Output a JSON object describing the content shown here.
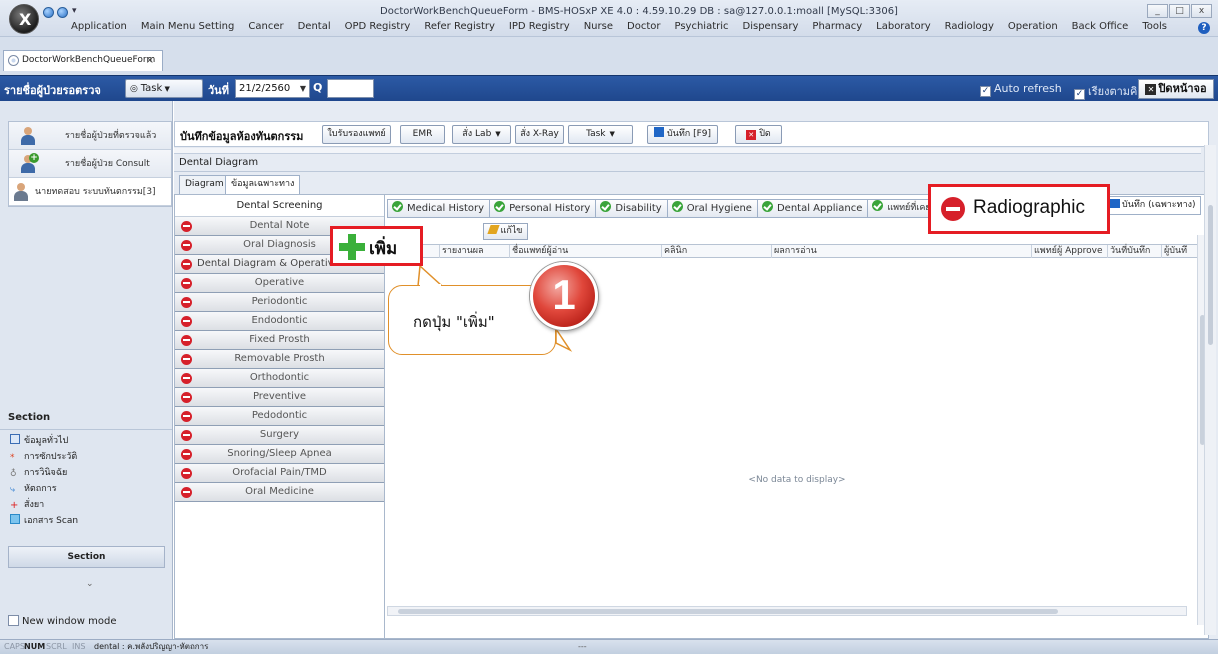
{
  "window": {
    "title": "DoctorWorkBenchQueueForm - BMS-HOSxP XE 4.0 : 4.59.10.29 DB : sa@127.0.0.1:moall [MySQL:3306]",
    "buttons": [
      "_",
      "□",
      "x"
    ]
  },
  "menu": [
    "Application",
    "Main Menu Setting",
    "Cancer",
    "Dental",
    "OPD Registry",
    "Refer Registry",
    "IPD Registry",
    "Nurse",
    "Doctor",
    "Psychiatric",
    "Dispensary",
    "Pharmacy",
    "Laboratory",
    "Radiology",
    "Operation",
    "Back Office",
    "Tools"
  ],
  "doc_tab": {
    "label": "DoctorWorkBenchQueueForm",
    "close": "×"
  },
  "toolbar": {
    "title": "รายชื่อผู้ป่วยรอตรวจ",
    "task_label": "Task",
    "date_label": "วันที่",
    "date_value": "21/2/2560",
    "q_label": "Q",
    "q_value": "",
    "auto_refresh": "Auto refresh",
    "sort_queue": "เรียงตามคิว",
    "close_screen": "ปิดหน้าจอ"
  },
  "patient_list": [
    {
      "label": "รายชื่อผู้ป่วยที่ตรวจแล้ว"
    },
    {
      "label": "รายชื่อผู้ป่วย Consult"
    },
    {
      "label": "นายทดสอบ ระบบทันตกรรม[3]"
    }
  ],
  "section": {
    "title": "Section",
    "items": [
      "ข้อมูลทั่วไป",
      "การซักประวัติ",
      "การวินิจฉัย",
      "หัตถการ",
      "สั่งยา",
      "เอกสาร Scan"
    ],
    "button": "Section",
    "dropdown": "⌄",
    "new_window": "New window mode"
  },
  "form": {
    "title": "บันทึกข้อมูลห้องทันตกรรม",
    "buttons": {
      "doctor_cert": "ใบรับรองแพทย์",
      "emr": "EMR",
      "order_lab": "สั่ง Lab",
      "order_xray": "สั่ง X-Ray",
      "task": "Task",
      "save": "บันทึก [F9]",
      "close": "ปิด"
    },
    "diagram_label": "Dental Diagram",
    "subtabs": [
      "Diagram",
      "ข้อมูลเฉพาะทาง"
    ]
  },
  "screening": {
    "header": "Dental Screening",
    "items": [
      "Dental Note",
      "Oral Diagnosis",
      "Dental Diagram & Operative Diagnosis",
      "Operative",
      "Periodontic",
      "Endodontic",
      "Fixed Prosth",
      "Removable Prosth",
      "Orthodontic",
      "Preventive",
      "Pedodontic",
      "Surgery",
      "Snoring/Sleep Apnea",
      "Orofacial Pain/TMD",
      "Oral Medicine"
    ]
  },
  "right_tabs": [
    "Medical History",
    "Personal History",
    "Disability",
    "Oral Hygiene",
    "Dental Appliance",
    "แพทย์ที่เคย"
  ],
  "save_specialty": "บันทึก (เฉพาะทาง)",
  "grid": {
    "edit_button": "แก้ไข",
    "columns": [
      "รายงานผล",
      "ชื่อแพทย์ผู้อ่าน",
      "คลินิก",
      "ผลการอ่าน",
      "แพทย์ผู้ Approve",
      "วันที่บันทึก",
      "ผู้บันทึ"
    ],
    "empty_text": "<No data to display>"
  },
  "annotations": {
    "add_button": "เพิ่ม",
    "radiographic": "Radiographic",
    "bubble_text": "กดปุ่ม \"เพิ่ม\"",
    "step_number": "1"
  },
  "status_bar": {
    "caps": "CAPS",
    "num": "NUM",
    "scrl": "SCRL",
    "ins": "INS",
    "user": "dental : ค.พลังปริญญา-หัตถการ",
    "dashes": "---"
  },
  "colors": {
    "accent_blue": "#1f478d",
    "callout_red": "#e51c23",
    "ok_green": "#3aa43a",
    "minus_red": "#d6202a"
  }
}
